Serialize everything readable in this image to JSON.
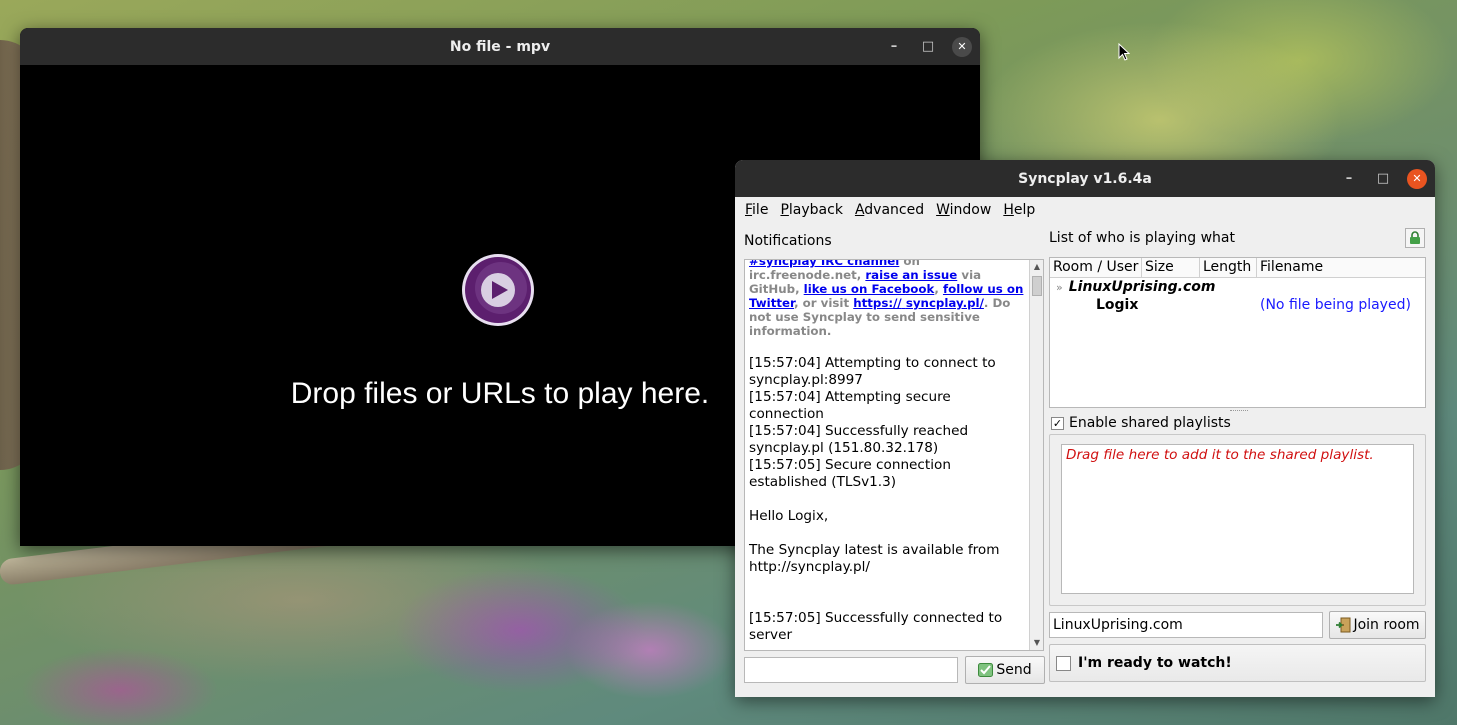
{
  "mpv": {
    "title": "No file - mpv",
    "drop_message": "Drop files or URLs to play here.",
    "controls": {
      "minimize": "–",
      "maximize": "□",
      "close": "✕"
    }
  },
  "syncplay": {
    "title": "Syncplay v1.6.4a",
    "controls": {
      "minimize": "–",
      "maximize": "□",
      "close": "✕"
    },
    "menu": [
      {
        "key": "F",
        "rest": "ile"
      },
      {
        "key": "P",
        "rest": "layback"
      },
      {
        "key": "A",
        "rest": "dvanced"
      },
      {
        "key": "W",
        "rest": "indow"
      },
      {
        "key": "H",
        "rest": "elp"
      }
    ],
    "notifications": {
      "label": "Notifications",
      "intro": {
        "link_irc": "#syncplay IRC channel",
        "text_irc": " on irc.freenode.net,",
        "link_issue": "raise an issue",
        "text_github": " via GitHub, ",
        "link_facebook": "like us on Facebook",
        "text_comma": ",",
        "link_twitter": "follow us on Twitter",
        "text_visit": ", or visit ",
        "link_site_a": "https://",
        "link_site_b": "syncplay.pl/",
        "text_warning": ". Do not use Syncplay to send sensitive information."
      },
      "messages": [
        "[15:57:04] Attempting to connect to syncplay.pl:8997",
        "[15:57:04] Attempting secure connection",
        "[15:57:04] Successfully reached syncplay.pl (151.80.32.178)",
        "[15:57:05] Secure connection established (TLSv1.3)"
      ],
      "hello": "Hello Logix,",
      "latest": "The Syncplay latest is available from http://syncplay.pl/",
      "connected": "[15:57:05] Successfully connected to server"
    },
    "chat": {
      "input_value": "",
      "send_label": "Send"
    },
    "userlist": {
      "label": "List of who is playing what",
      "columns": [
        "Room / User",
        "Size",
        "Length",
        "Filename"
      ],
      "room": "LinuxUprising.com",
      "user": "Logix",
      "user_file": "(No file being played)"
    },
    "shared_playlists": {
      "checkbox_label": "Enable shared playlists",
      "checked_glyph": "✓",
      "hint": "Drag file here to add it to the shared playlist."
    },
    "room_input_value": "LinuxUprising.com",
    "join_label": "Join room",
    "ready_label": "I'm ready to watch!",
    "colors": {
      "accent_close": "#e95420",
      "link": "#0000ee",
      "file_status": "#1a1aff",
      "hint": "#d01010"
    }
  }
}
